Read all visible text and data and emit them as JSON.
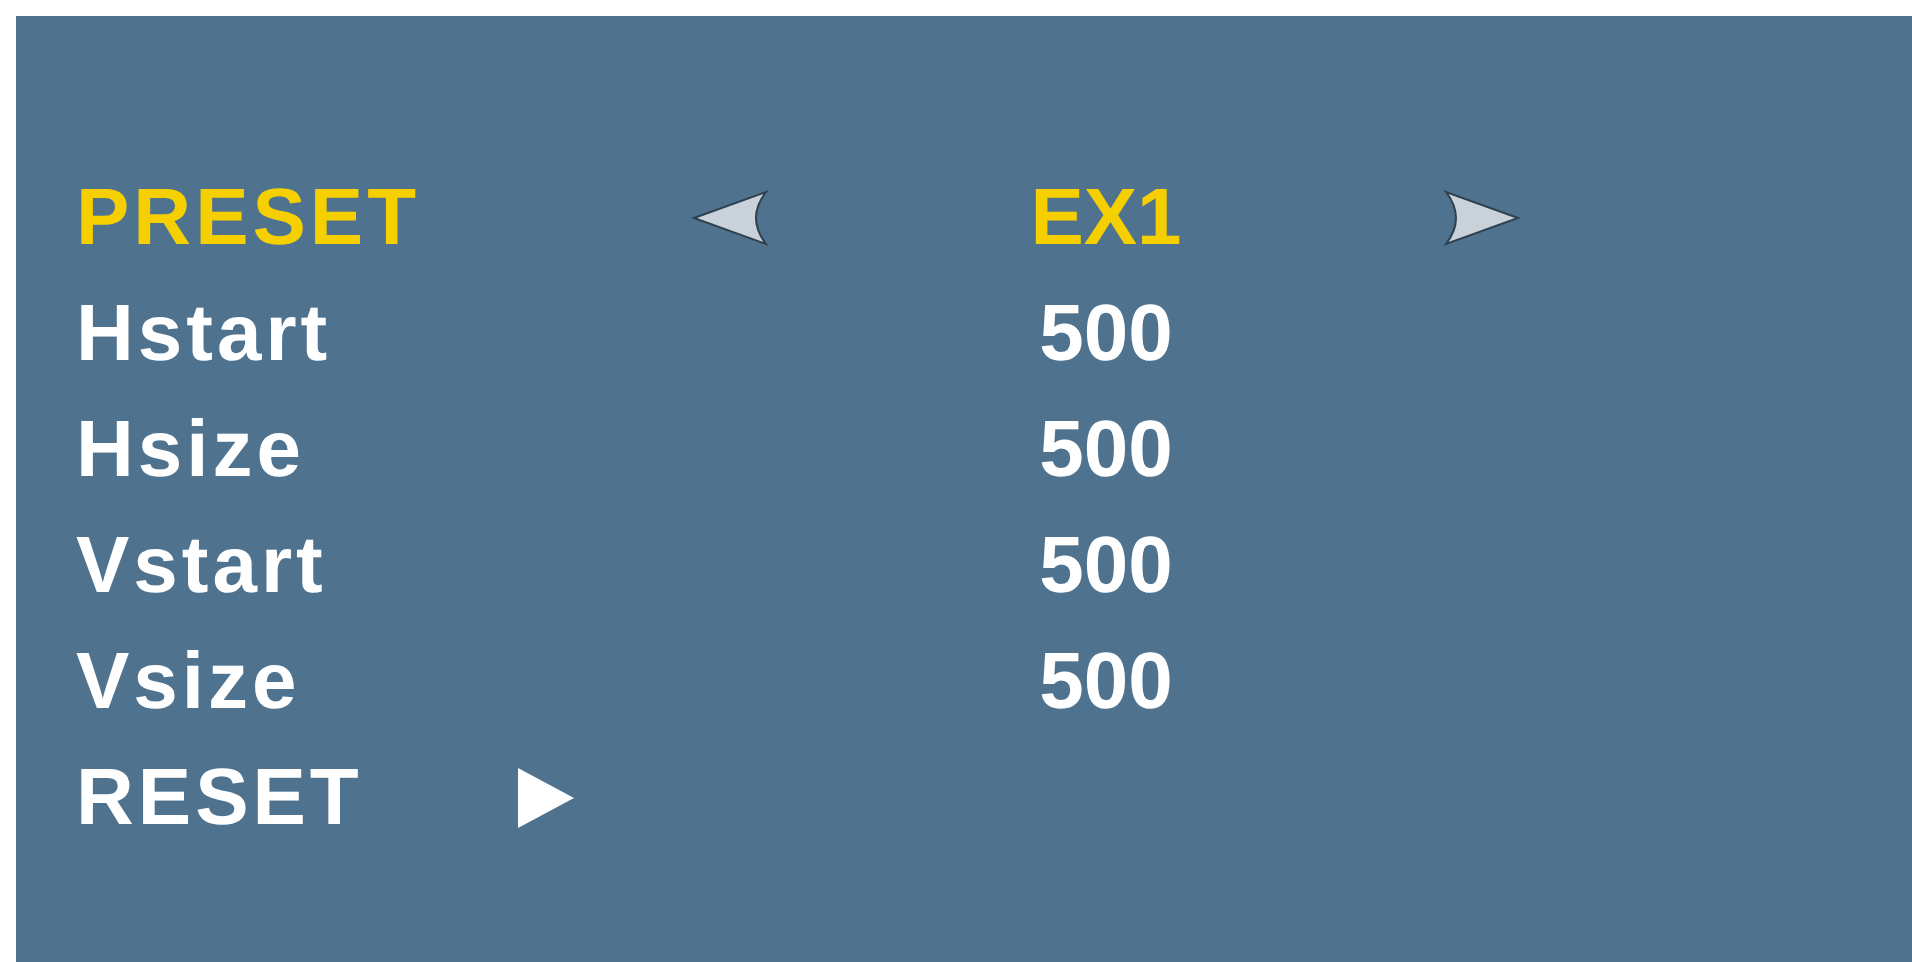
{
  "menu": {
    "rows": [
      {
        "kind": "select",
        "label": "PRESET",
        "value": "EX1",
        "selected": true
      },
      {
        "kind": "value",
        "label": "Hstart",
        "value": "500",
        "selected": false
      },
      {
        "kind": "value",
        "label": "Hsize",
        "value": "500",
        "selected": false
      },
      {
        "kind": "value",
        "label": "Vstart",
        "value": "500",
        "selected": false
      },
      {
        "kind": "value",
        "label": "Vsize",
        "value": "500",
        "selected": false
      },
      {
        "kind": "action",
        "label": "RESET",
        "selected": false
      }
    ]
  }
}
